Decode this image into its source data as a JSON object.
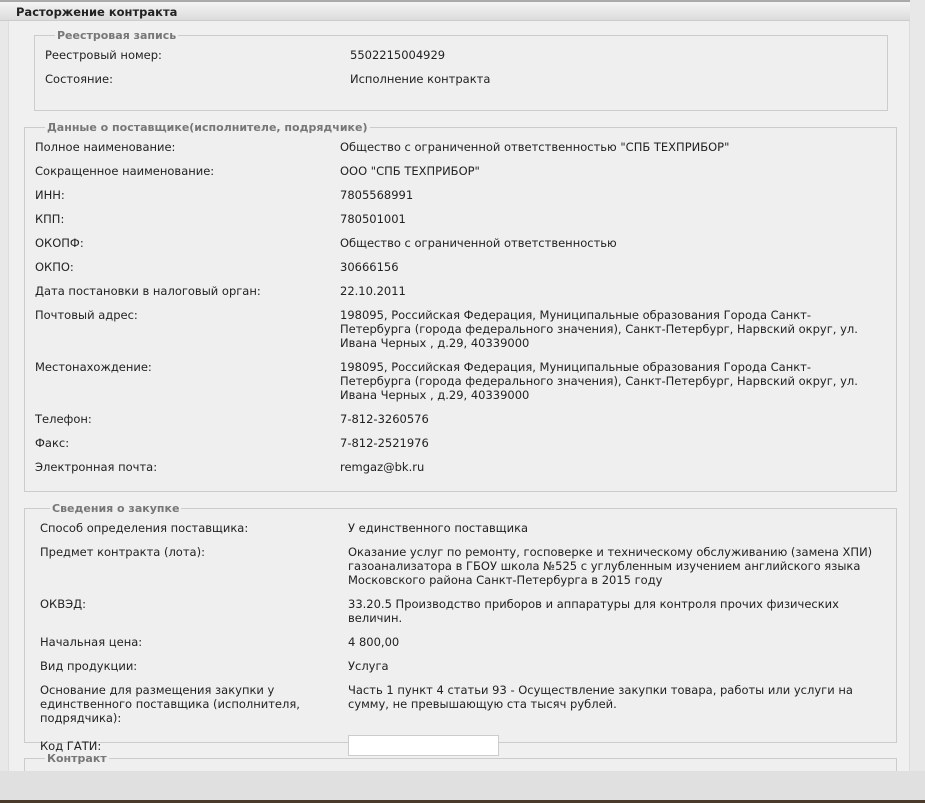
{
  "title": "Расторжение контракта",
  "registry": {
    "legend": "Реестровая запись",
    "rows": [
      {
        "label": "Реестровый номер:",
        "value": "5502215004929"
      },
      {
        "label": "Состояние:",
        "value": "Исполнение контракта"
      }
    ]
  },
  "supplier": {
    "legend": "Данные о поставщике(исполнителе, подрядчике)",
    "rows": [
      {
        "label": "Полное наименование:",
        "value": "Общество с ограниченной ответственностью \"СПБ ТЕХПРИБОР\""
      },
      {
        "label": "Сокращенное наименование:",
        "value": "ООО \"СПБ ТЕХПРИБОР\""
      },
      {
        "label": "ИНН:",
        "value": "7805568991"
      },
      {
        "label": "КПП:",
        "value": "780501001"
      },
      {
        "label": "ОКОПФ:",
        "value": "Общество с ограниченной ответственностью"
      },
      {
        "label": "ОКПО:",
        "value": "30666156"
      },
      {
        "label": "Дата постановки в налоговый орган:",
        "value": "22.10.2011"
      },
      {
        "label": "Почтовый адрес:",
        "value": "198095, Российская Федерация, Муниципальные образования Города Санкт-Петербурга (города федерального значения), Санкт-Петербург, Нарвский округ, ул. Ивана Черных , д.29, 40339000"
      },
      {
        "label": "Местонахождение:",
        "value": "198095, Российская Федерация, Муниципальные образования Города Санкт-Петербурга (города федерального значения), Санкт-Петербург, Нарвский округ, ул. Ивана Черных , д.29, 40339000"
      },
      {
        "label": "Телефон:",
        "value": "7-812-3260576"
      },
      {
        "label": "Факс:",
        "value": "7-812-2521976"
      },
      {
        "label": "Электронная почта:",
        "value": "remgaz@bk.ru"
      }
    ]
  },
  "purchase": {
    "legend": "Сведения о закупке",
    "rows": [
      {
        "label": "Способ определения поставщика:",
        "value": "У единственного поставщика"
      },
      {
        "label": "Предмет контракта (лота):",
        "value": "Оказание услуг по ремонту, госповерке и техническому обслуживанию (замена ХПИ) газоанализатора в ГБОУ школа №525 с углубленным изучением английского языка Московского района Санкт-Петербурга в 2015 году"
      },
      {
        "label": "ОКВЭД:",
        "value": "33.20.5 Производство приборов и аппаратуры для контроля прочих физических величин."
      },
      {
        "label": "Начальная цена:",
        "value": "4 800,00"
      },
      {
        "label": "Вид продукции:",
        "value": "Услуга"
      },
      {
        "label": "Основание для размещения закупки у единственного поставщика (исполнителя, подрядчика):",
        "value": "Часть 1 пункт 4 статьи 93 - Осуществление закупки товара, работы или услуги на сумму, не превышающую ста тысяч рублей."
      }
    ],
    "gati_label": "Код ГАТИ:",
    "gati_value": ""
  },
  "contract": {
    "legend": "Контракт"
  }
}
